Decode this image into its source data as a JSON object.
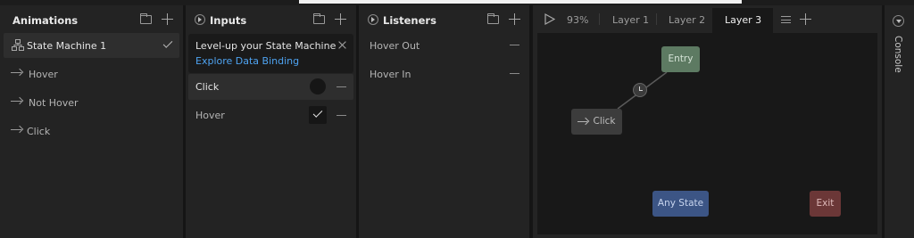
{
  "animations": {
    "title": "Animations",
    "items": [
      {
        "label": "State Machine 1",
        "type": "state-machine"
      },
      {
        "label": "Hover",
        "type": "animation"
      },
      {
        "label": "Not Hover",
        "type": "animation"
      },
      {
        "label": "Click",
        "type": "animation"
      }
    ]
  },
  "inputs": {
    "title": "Inputs",
    "promo": {
      "text": "Level-up your State Machine",
      "link": "Explore Data Binding"
    },
    "items": [
      {
        "label": "Click",
        "kind": "trigger"
      },
      {
        "label": "Hover",
        "kind": "boolean",
        "checked": true
      }
    ]
  },
  "listeners": {
    "title": "Listeners",
    "items": [
      {
        "label": "Hover Out"
      },
      {
        "label": "Hover In"
      }
    ]
  },
  "graph": {
    "zoom": "93%",
    "tabs": [
      {
        "label": "Layer 1",
        "active": false
      },
      {
        "label": "Layer 2",
        "active": false
      },
      {
        "label": "Layer 3",
        "active": true
      }
    ],
    "nodes": {
      "entry": "Entry",
      "click": "Click",
      "any_state": "Any State",
      "exit": "Exit"
    }
  },
  "console": {
    "label": "Console"
  },
  "colors": {
    "entry": "#5d7a62",
    "any_state": "#3c5585",
    "exit": "#6b3737",
    "link": "#4ea3f1"
  }
}
